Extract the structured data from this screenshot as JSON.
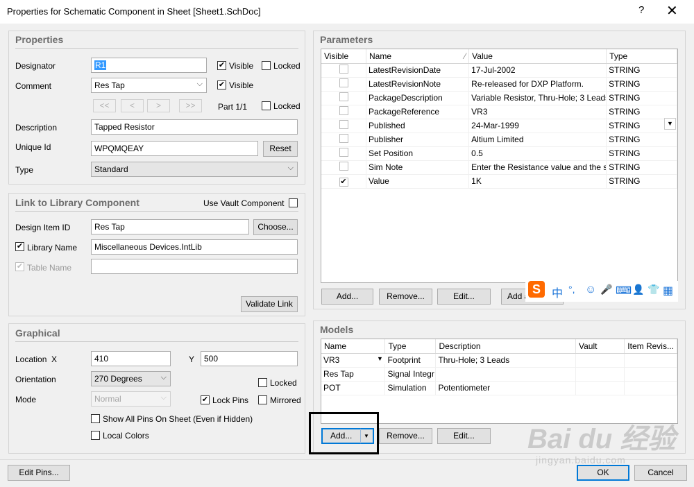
{
  "window": {
    "title": "Properties for Schematic Component in Sheet [Sheet1.SchDoc]",
    "help": "?",
    "close": "✕"
  },
  "properties": {
    "title": "Properties",
    "designator_label": "Designator",
    "designator_value": "R1",
    "comment_label": "Comment",
    "comment_value": "Res Tap",
    "visible_label": "Visible",
    "locked_label": "Locked",
    "nav_first": "<<",
    "nav_prev": "<",
    "nav_next": ">",
    "nav_last": ">>",
    "part_text": "Part 1/1",
    "description_label": "Description",
    "description_value": "Tapped Resistor",
    "unique_id_label": "Unique Id",
    "unique_id_value": "WPQMQEAY",
    "reset_label": "Reset",
    "type_label": "Type",
    "type_value": "Standard"
  },
  "library": {
    "title": "Link to Library Component",
    "use_vault_label": "Use Vault Component",
    "design_item_label": "Design Item ID",
    "design_item_value": "Res Tap",
    "choose_label": "Choose...",
    "library_name_label": "Library Name",
    "library_name_value": "Miscellaneous Devices.IntLib",
    "table_name_label": "Table Name",
    "table_name_value": "",
    "validate_label": "Validate Link"
  },
  "graphical": {
    "title": "Graphical",
    "location_label": "Location",
    "x_label": "X",
    "x_value": "410",
    "y_label": "Y",
    "y_value": "500",
    "orientation_label": "Orientation",
    "orientation_value": "270 Degrees",
    "locked_label": "Locked",
    "mode_label": "Mode",
    "mode_value": "Normal",
    "lock_pins_label": "Lock Pins",
    "mirrored_label": "Mirrored",
    "show_pins_label": "Show All Pins On Sheet (Even if Hidden)",
    "local_colors_label": "Local Colors"
  },
  "parameters": {
    "title": "Parameters",
    "columns": [
      "Visible",
      "Name",
      "Value",
      "Type"
    ],
    "rows": [
      {
        "name": "LatestRevisionDate",
        "value": "17-Jul-2002",
        "type": "STRING",
        "visible": ""
      },
      {
        "name": "LatestRevisionNote",
        "value": "Re-released for DXP Platform.",
        "type": "STRING",
        "visible": ""
      },
      {
        "name": "PackageDescription",
        "value": "Variable Resistor, Thru-Hole; 3 Leads",
        "type": "STRING",
        "visible": ""
      },
      {
        "name": "PackageReference",
        "value": "VR3",
        "type": "STRING",
        "visible": ""
      },
      {
        "name": "Published",
        "value": "24-Mar-1999",
        "type": "STRING",
        "visible": ""
      },
      {
        "name": "Publisher",
        "value": "Altium Limited",
        "type": "STRING",
        "visible": ""
      },
      {
        "name": "Set Position",
        "value": "0.5",
        "type": "STRING",
        "visible": ""
      },
      {
        "name": "Sim Note",
        "value": "Enter the Resistance value and the s",
        "type": "STRING",
        "visible": ""
      },
      {
        "name": "Value",
        "value": "1K",
        "type": "STRING",
        "visible": "✔"
      }
    ],
    "add_label": "Add...",
    "remove_label": "Remove...",
    "edit_label": "Edit...",
    "add_as_label": "Add as"
  },
  "models": {
    "title": "Models",
    "columns": [
      "Name",
      "Type",
      "Description",
      "Vault",
      "Item Revis..."
    ],
    "rows": [
      {
        "name": "VR3",
        "type": "Footprint",
        "description": "Thru-Hole; 3 Leads"
      },
      {
        "name": "Res Tap",
        "type": "Signal Integr",
        "description": ""
      },
      {
        "name": "POT",
        "type": "Simulation",
        "description": "Potentiometer"
      }
    ],
    "add_label": "Add...",
    "remove_label": "Remove...",
    "edit_label": "Edit..."
  },
  "footer": {
    "edit_pins_label": "Edit Pins...",
    "ok_label": "OK",
    "cancel_label": "Cancel"
  },
  "ime": {
    "logo": "S",
    "zh": "中",
    "punct": "°,",
    "emoji": "☺",
    "mic": "🎤",
    "keyboard": "⌨",
    "user": "👤",
    "shirt": "👕",
    "grid": "▦"
  },
  "watermark": {
    "main": "Bai du 经验",
    "sub": "jingyan.baidu.com"
  },
  "colors": {
    "accent": "#0078d7",
    "selection": "#3399ff",
    "ime_orange": "#ff6a00",
    "ime_blue": "#1a74d9"
  }
}
